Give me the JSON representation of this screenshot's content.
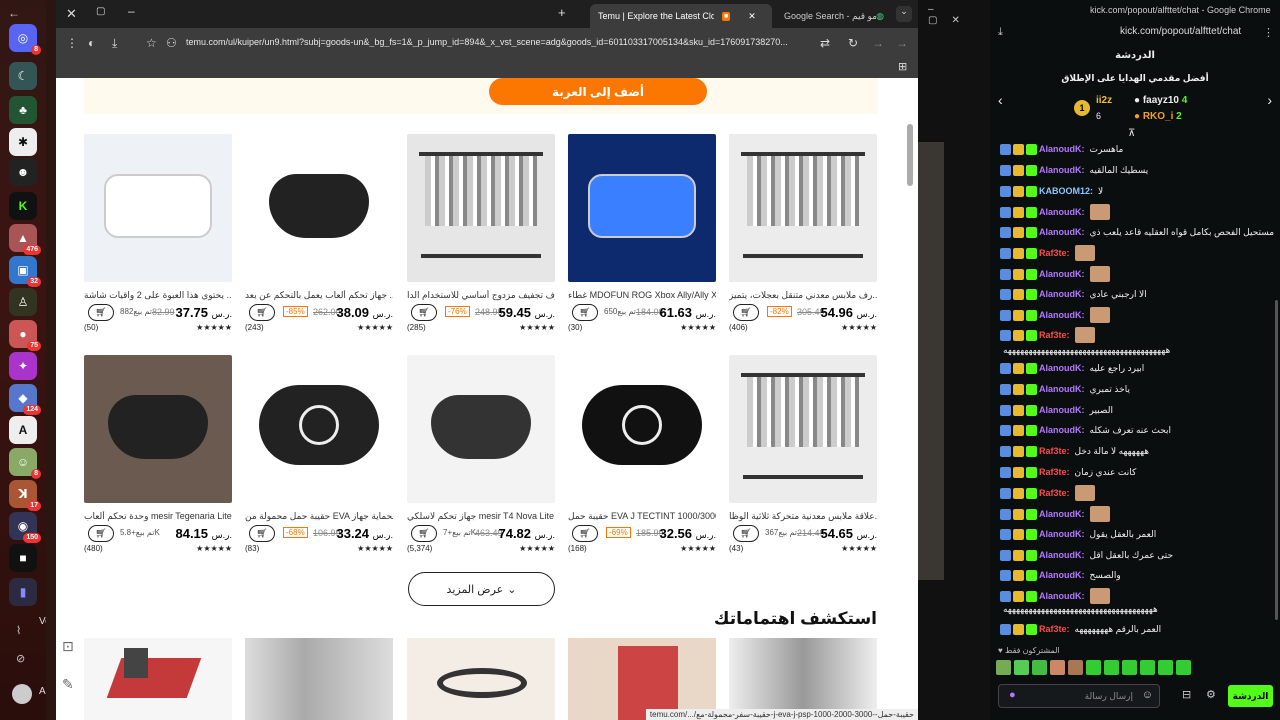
{
  "dock": {
    "badges": [
      "8",
      "476",
      "32",
      "75",
      "124",
      "8",
      "17",
      "150"
    ],
    "caption_voice": "Voi",
    "caption_user": "A..."
  },
  "browser": {
    "tabs": [
      {
        "label": "Temu | Explore the Latest Cloth",
        "active": true
      },
      {
        "label": "Google Search - تيمو قيم",
        "active": false
      }
    ],
    "url": "temu.com/ul/kuiper/un9.html?subj=goods-un&_bg_fs=1&_p_jump_id=894&_x_vst_scene=adg&goods_id=601103317005134&sku_id=176091738270...",
    "status_url": "temu.com/.../حقيبة-سفر-محمولة-مع-j-eva-j-psp-1000-2000-3000--حقيبة-حمل"
  },
  "page": {
    "add_to_cart": "أضف إلى العربة",
    "show_more": "عرض المزيد",
    "explore_heading": "استكشف اهتماماتك",
    "products": [
      {
        "title": "يحتوي هذا العبوة على 2 واقيات شاشة ...",
        "price": "37.75",
        "currency": "ر.س.",
        "old": "82.99",
        "badge": "",
        "sold": "تم بيع882",
        "reviews": "(50)"
      },
      {
        "title": "جهاز تحكم ألعاب يعمل بالتحكم عن بعد ...",
        "price": "38.09",
        "currency": "ر.س.",
        "old": "262.00",
        "badge": "-85%",
        "sold": "",
        "reviews": "(243)"
      },
      {
        "title": "رف تجفيف مزدوج أساسي للاستخدام الدا...",
        "price": "59.45",
        "currency": "ر.س.",
        "old": "248.99",
        "badge": "-76%",
        "sold": "",
        "reviews": "(285)"
      },
      {
        "title": "غطاء MDOFUN ROG Xbox Ally/Ally X...",
        "price": "61.63",
        "currency": "ر.س.",
        "old": "184.00",
        "badge": "",
        "sold": "تم بيع650",
        "reviews": "(30)"
      },
      {
        "title": "رف ملابس معدني متنقل بعجلات، يتميز...",
        "price": "54.96",
        "currency": "ر.س.",
        "old": "305.49",
        "badge": "-82%",
        "sold": "",
        "reviews": "(406)"
      },
      {
        "title": "وحدة تحكم ألعاب mesir Tegenaria Lite...",
        "price": "84.15",
        "currency": "ر.س.",
        "old": "",
        "badge": "",
        "sold": "تم بيع+5.8K",
        "reviews": "(480)"
      },
      {
        "title": "حقيبة حمل محمولة من EVA لحماية جهاز...",
        "price": "33.24",
        "currency": "ر.س.",
        "old": "106.99",
        "badge": "-68%",
        "sold": "",
        "reviews": "(83)"
      },
      {
        "title": "جهاز تحكم لاسلكي mesir T4 Nova Lite...",
        "price": "74.82",
        "currency": "ر.س.",
        "old": "463.49",
        "badge": "",
        "sold": "تم بيع+7K",
        "reviews": "(5,374)"
      },
      {
        "title": "حقيبة حمل EVA J TECTINT 1000/3000...",
        "price": "32.56",
        "currency": "ر.س.",
        "old": "185.99",
        "badge": "-69%",
        "sold": "",
        "reviews": "(168)"
      },
      {
        "title": "علاقة ملابس معدنية متحركة ثلاثية الوظا...",
        "price": "54.65",
        "currency": "ر.س.",
        "old": "214.49",
        "badge": "",
        "sold": "تم بيع367",
        "reviews": "(43)"
      }
    ]
  },
  "kick": {
    "window_title": "kick.com/popout/alfttet/chat - Google Chrome",
    "url": "kick.com/popout/alfttet/chat",
    "header": "الدردشة",
    "gifters_title": "أفضل مقدمي الهدايا على الإطلاق",
    "gifters": [
      {
        "rank": "1",
        "name": "ii2z",
        "count": "6"
      },
      {
        "name": "faayz10",
        "count": "4"
      },
      {
        "name": "RKO_i",
        "count": "2"
      }
    ],
    "messages": [
      {
        "user": "AlanoudK",
        "color": "#b478ff",
        "text": "ماهسرت"
      },
      {
        "user": "AlanoudK",
        "color": "#b478ff",
        "text": "يسطيك المالقيه"
      },
      {
        "user": "KABOOM12",
        "color": "#8ac7ff",
        "text": "لا"
      },
      {
        "user": "AlanoudK",
        "color": "#b478ff",
        "text": ""
      },
      {
        "user": "AlanoudK",
        "color": "#b478ff",
        "text": "مستحيل الفحص بكامل قواه العقليه قاعد يلعب ذي"
      },
      {
        "user": "Raf3te",
        "color": "#ff4b4b",
        "text": ""
      },
      {
        "user": "AlanoudK",
        "color": "#b478ff",
        "text": ""
      },
      {
        "user": "AlanoudK",
        "color": "#b478ff",
        "text": "الا ارجبني عادي"
      },
      {
        "user": "AlanoudK",
        "color": "#b478ff",
        "text": ""
      },
      {
        "user": "Raf3te",
        "color": "#ff4b4b",
        "text": ""
      },
      {
        "user": "",
        "color": "#ddd",
        "text": "هههههههههههههههههههههههههههههههههههههههه"
      },
      {
        "user": "AlanoudK",
        "color": "#b478ff",
        "text": "ابيرد راجع عليه"
      },
      {
        "user": "AlanoudK",
        "color": "#b478ff",
        "text": "ياخذ تمبري"
      },
      {
        "user": "AlanoudK",
        "color": "#b478ff",
        "text": "الصبير"
      },
      {
        "user": "AlanoudK",
        "color": "#b478ff",
        "text": "ابحث عنه تعرف شكله"
      },
      {
        "user": "Raf3te",
        "color": "#ff4b4b",
        "text": "ههههههه لا مالة دخل"
      },
      {
        "user": "Raf3te",
        "color": "#ff4b4b",
        "text": "كانت عندي زمان"
      },
      {
        "user": "Raf3te",
        "color": "#ff4b4b",
        "text": ""
      },
      {
        "user": "AlanoudK",
        "color": "#b478ff",
        "text": ""
      },
      {
        "user": "AlanoudK",
        "color": "#b478ff",
        "text": "العمر بالعقل يقول"
      },
      {
        "user": "AlanoudK",
        "color": "#b478ff",
        "text": "حتى عمرك بالعقل اقل"
      },
      {
        "user": "AlanoudK",
        "color": "#b478ff",
        "text": "والصسح"
      },
      {
        "user": "AlanoudK",
        "color": "#b478ff",
        "text": ""
      },
      {
        "user": "",
        "color": "#ddd",
        "text": "ههههههههههههههههههههههههههههههههههههه"
      },
      {
        "user": "Raf3te",
        "color": "#ff4b4b",
        "text": "العمر بالرقم ههههههههه"
      }
    ],
    "subs_only": "المشتركون فقط",
    "input_placeholder": "إرسال رسالة",
    "send_label": "الدردشة"
  }
}
